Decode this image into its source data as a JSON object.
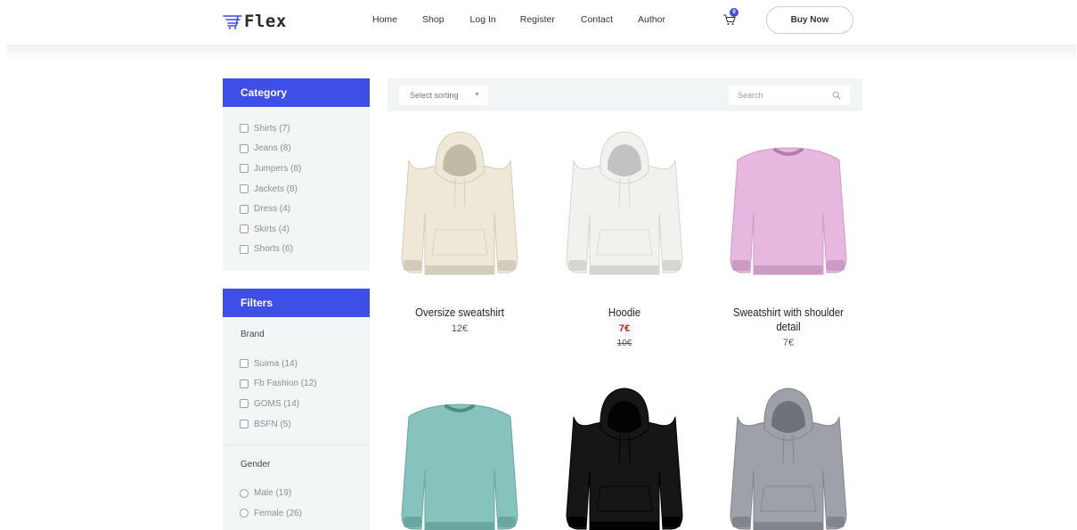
{
  "brand": {
    "logo_text": "Flex",
    "logo_icon": "cart-lines-icon"
  },
  "nav": {
    "items": [
      {
        "label": "Home"
      },
      {
        "label": "Shop"
      },
      {
        "label": "Log In"
      },
      {
        "label": "Register"
      },
      {
        "label": "Contact"
      },
      {
        "label": "Author"
      }
    ],
    "cart_count": "0",
    "buy_label": "Buy Now"
  },
  "category": {
    "title": "Category",
    "items": [
      {
        "label": "Shirts (7)"
      },
      {
        "label": "Jeans (8)"
      },
      {
        "label": "Jumpers (8)"
      },
      {
        "label": "Jackets (8)"
      },
      {
        "label": "Dress (4)"
      },
      {
        "label": "Skirts (4)"
      },
      {
        "label": "Shorts (6)"
      }
    ]
  },
  "filters": {
    "title": "Filters",
    "brand_title": "Brand",
    "brands": [
      {
        "label": "Suima (14)"
      },
      {
        "label": "Fb Fashion (12)"
      },
      {
        "label": "GOMS (14)"
      },
      {
        "label": "BSFN (5)"
      }
    ],
    "gender_title": "Gender",
    "genders": [
      {
        "label": "Male (19)"
      },
      {
        "label": "Female (26)"
      }
    ]
  },
  "toolbar": {
    "sort_label": "Select sorting",
    "search_placeholder": "Search"
  },
  "products": [
    {
      "name": "Oversize sweatshirt",
      "price": "12€",
      "old_price": "",
      "color": "#efe8d6",
      "garment": "hoodie"
    },
    {
      "name": "Hoodie",
      "price": "7€",
      "old_price": "10€",
      "color": "#f2f1ee",
      "garment": "hoodie"
    },
    {
      "name": "Sweatshirt with shoulder detail",
      "price": "7€",
      "old_price": "",
      "color": "#e7b7df",
      "garment": "sweatshirt"
    },
    {
      "name": "",
      "price": "",
      "old_price": "",
      "color": "#86c3bc",
      "garment": "sweatshirt"
    },
    {
      "name": "",
      "price": "",
      "old_price": "",
      "color": "#161616",
      "garment": "hoodie"
    },
    {
      "name": "",
      "price": "",
      "old_price": "",
      "color": "#9ea1a8",
      "garment": "hoodie"
    }
  ],
  "colors": {
    "accent": "#3d4fe7",
    "sale": "#c61b1b",
    "sidebar_bg": "#f3f6f6"
  }
}
